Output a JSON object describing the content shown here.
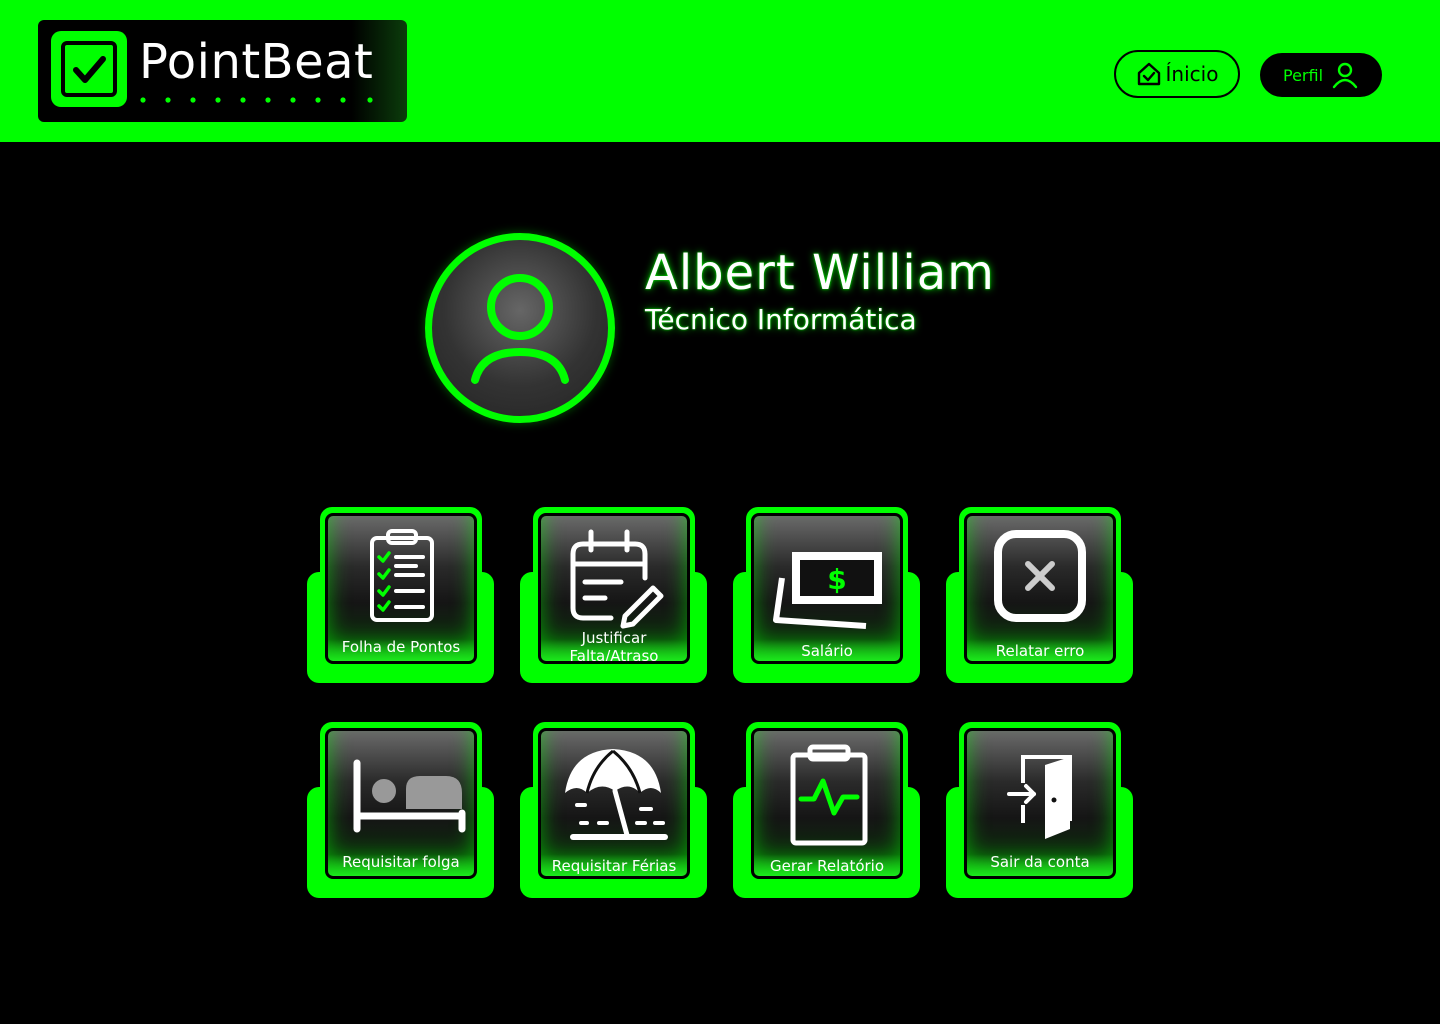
{
  "header": {
    "logo_text": "PointBeat",
    "nav": {
      "inicio_label": "Ínicio",
      "perfil_label": "Perfil"
    }
  },
  "profile": {
    "name": "Albert William",
    "role": "Técnico Informática"
  },
  "tiles": [
    {
      "label": "Folha de Pontos",
      "icon": "clipboard-checklist-icon"
    },
    {
      "label_line1": "Justificar",
      "label_line2": "Falta/Atraso",
      "icon": "calendar-edit-icon"
    },
    {
      "label": "Salário",
      "icon": "money-bill-icon"
    },
    {
      "label": "Relatar erro",
      "icon": "x-square-icon"
    },
    {
      "label": "Requisitar folga",
      "icon": "bed-icon"
    },
    {
      "label": "Requisitar Férias",
      "icon": "beach-umbrella-icon"
    },
    {
      "label": "Gerar Relatório",
      "icon": "report-clipboard-icon"
    },
    {
      "label": "Sair da conta",
      "icon": "logout-door-icon"
    }
  ],
  "colors": {
    "accent": "#00ff00",
    "background": "#000000",
    "text": "#ffffff"
  }
}
